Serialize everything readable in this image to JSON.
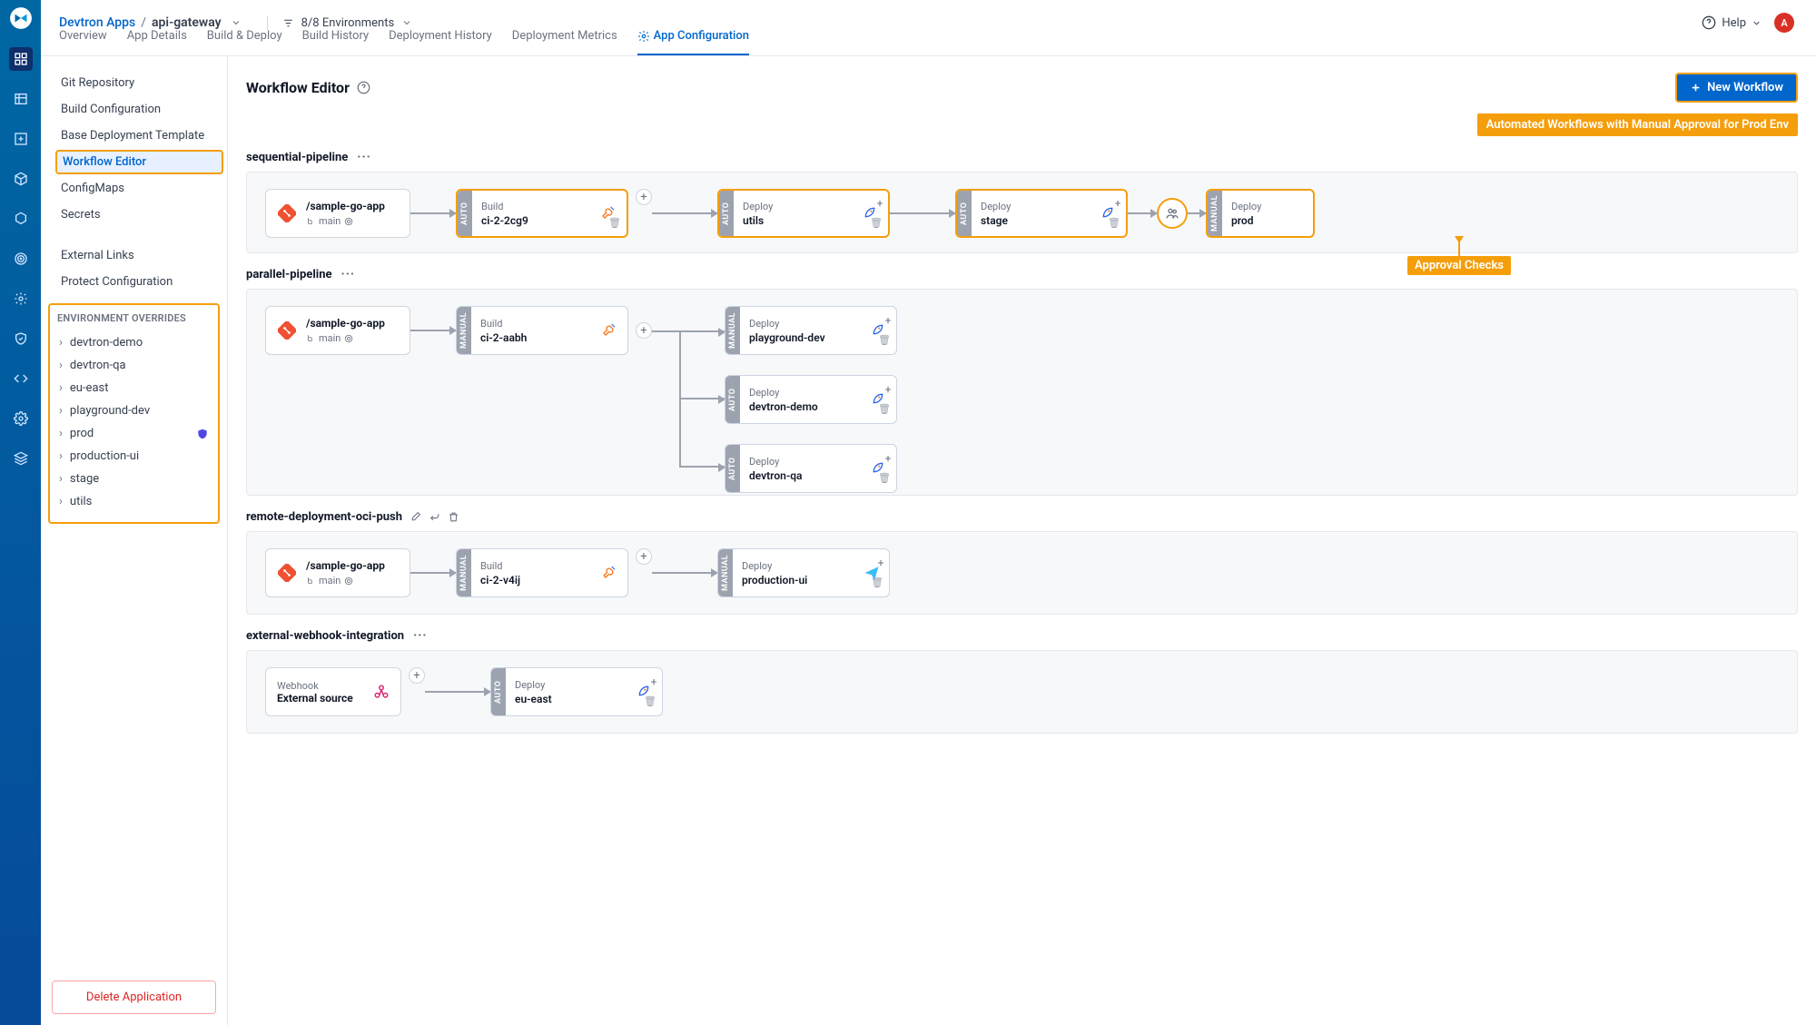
{
  "header": {
    "breadcrumb_root": "Devtron Apps",
    "breadcrumb_current": "api-gateway",
    "env_summary": "8/8 Environments",
    "help_label": "Help",
    "avatar_initial": "A",
    "tabs": [
      "Overview",
      "App Details",
      "Build & Deploy",
      "Build History",
      "Deployment History",
      "Deployment Metrics",
      "App Configuration"
    ]
  },
  "sidenav": {
    "items": [
      "Git Repository",
      "Build Configuration",
      "Base Deployment Template",
      "Workflow Editor",
      "ConfigMaps",
      "Secrets"
    ],
    "extra": [
      "External Links",
      "Protect Configuration"
    ],
    "env_heading": "ENVIRONMENT OVERRIDES",
    "envs": [
      "devtron-demo",
      "devtron-qa",
      "eu-east",
      "playground-dev",
      "prod",
      "production-ui",
      "stage",
      "utils"
    ],
    "delete_label": "Delete Application"
  },
  "page": {
    "title": "Workflow Editor",
    "new_workflow": "New Workflow",
    "banner": "Automated Workflows with Manual Approval for Prod Env",
    "approval_label": "Approval Checks"
  },
  "workflows": [
    {
      "name": "sequential-pipeline",
      "source": {
        "title": "/sample-go-app",
        "branch": "main"
      },
      "build": {
        "tag": "AUTO",
        "label": "Build",
        "value": "ci-2-2cg9"
      },
      "deploys": [
        {
          "tag": "AUTO",
          "label": "Deploy",
          "value": "utils"
        },
        {
          "tag": "AUTO",
          "label": "Deploy",
          "value": "stage"
        },
        {
          "tag": "MANUAL",
          "label": "Deploy",
          "value": "prod"
        }
      ],
      "approval_after_index": 1
    },
    {
      "name": "parallel-pipeline",
      "source": {
        "title": "/sample-go-app",
        "branch": "main"
      },
      "build": {
        "tag": "MANUAL",
        "label": "Build",
        "value": "ci-2-aabh"
      },
      "fan_deploys": [
        {
          "tag": "MANUAL",
          "label": "Deploy",
          "value": "playground-dev"
        },
        {
          "tag": "AUTO",
          "label": "Deploy",
          "value": "devtron-demo"
        },
        {
          "tag": "AUTO",
          "label": "Deploy",
          "value": "devtron-qa"
        }
      ]
    },
    {
      "name": "remote-deployment-oci-push",
      "source": {
        "title": "/sample-go-app",
        "branch": "main"
      },
      "build": {
        "tag": "MANUAL",
        "label": "Build",
        "value": "ci-2-v4ij"
      },
      "deploys": [
        {
          "tag": "MANUAL",
          "label": "Deploy",
          "value": "production-ui",
          "icon": "paperplane"
        }
      ]
    },
    {
      "name": "external-webhook-integration",
      "webhook": {
        "label": "Webhook",
        "value": "External source"
      },
      "deploys": [
        {
          "tag": "AUTO",
          "label": "Deploy",
          "value": "eu-east"
        }
      ]
    }
  ]
}
